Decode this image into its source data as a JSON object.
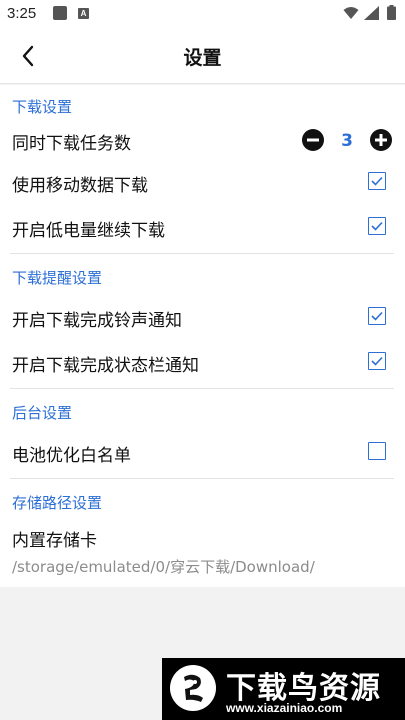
{
  "status_bar": {
    "time": "3:25",
    "notification_icons": [
      "square-notification-icon",
      "a-notification-icon"
    ],
    "system_icons": [
      "wifi-icon",
      "signal-icon",
      "battery-icon"
    ]
  },
  "app_bar": {
    "back_icon": "chevron-left-icon",
    "title": "设置"
  },
  "sections": {
    "download": {
      "header": "下载设置",
      "concurrent_tasks": {
        "label": "同时下载任务数",
        "value": "3"
      },
      "mobile_data": {
        "label": "使用移动数据下载",
        "checked": true
      },
      "low_battery": {
        "label": "开启低电量继续下载",
        "checked": true
      }
    },
    "reminder": {
      "header": "下载提醒设置",
      "ringtone": {
        "label": "开启下载完成铃声通知",
        "checked": true
      },
      "statusbar_notice": {
        "label": "开启下载完成状态栏通知",
        "checked": true
      }
    },
    "background": {
      "header": "后台设置",
      "battery_whitelist": {
        "label": "电池优化白名单",
        "checked": false
      }
    },
    "storage": {
      "header": "存储路径设置",
      "location": "内置存储卡",
      "path": "/storage/emulated/0/穿云下载/Download/"
    }
  },
  "colors": {
    "accent": "#2d6fd6",
    "text": "#111111",
    "secondary_text": "#8c8c8c",
    "page_bg": "#f2f2f2"
  },
  "watermark": {
    "title": "下载鸟资源",
    "url": "www.xiazainiao.com"
  }
}
